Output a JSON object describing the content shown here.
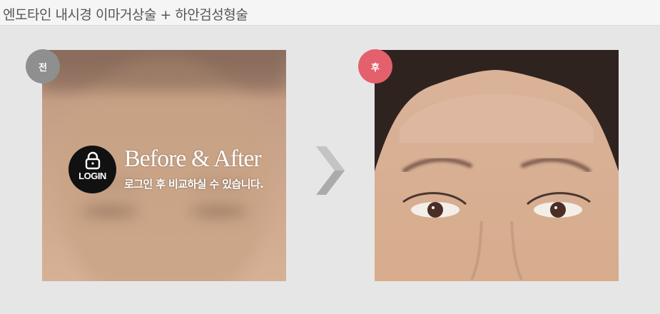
{
  "header": {
    "title": "엔도타인 내시경 이마거상술 + 하안검성형술"
  },
  "before": {
    "badge": "전",
    "login_label": "LOGIN",
    "overlay_title": "Before & After",
    "overlay_subtitle": "로그인 후 비교하실 수 있습니다."
  },
  "after": {
    "badge": "후"
  },
  "icons": {
    "lock": "lock-icon",
    "next": "chevron-right-icon"
  },
  "colors": {
    "before_badge": "#8f8f8f",
    "after_badge": "#e4606d",
    "login_circle": "#111111"
  }
}
